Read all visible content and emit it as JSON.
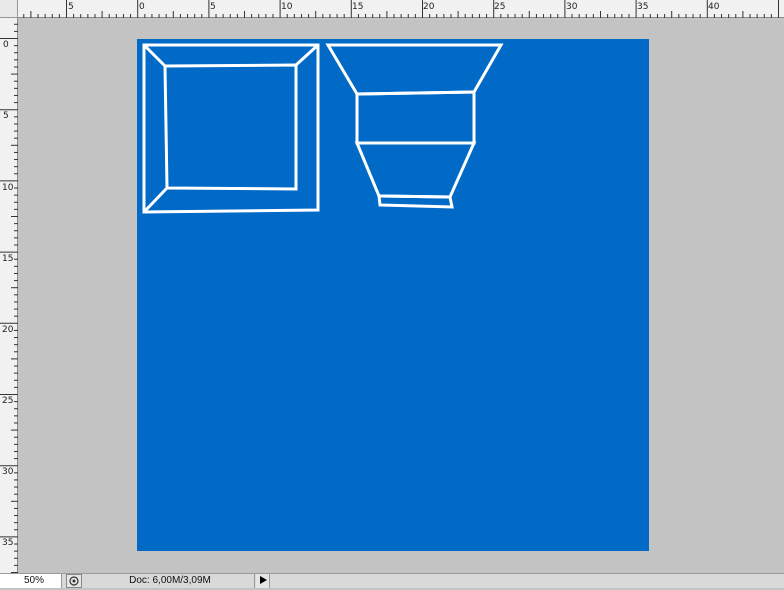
{
  "rulers": {
    "top_labels": [
      "5",
      "0",
      "5",
      "10",
      "15",
      "20",
      "25",
      "30",
      "35",
      "40"
    ],
    "left_labels": [
      "0",
      "5",
      "10",
      "15",
      "20",
      "25",
      "30",
      "35"
    ]
  },
  "document": {
    "background_color": "#0169c6",
    "stroke_color": "#ffffff"
  },
  "status": {
    "zoom": "50%",
    "doc_info": "Doc: 6,00M/3,09M",
    "status_icon": "document-info-icon",
    "menu_icon": "triangle-right-icon"
  }
}
